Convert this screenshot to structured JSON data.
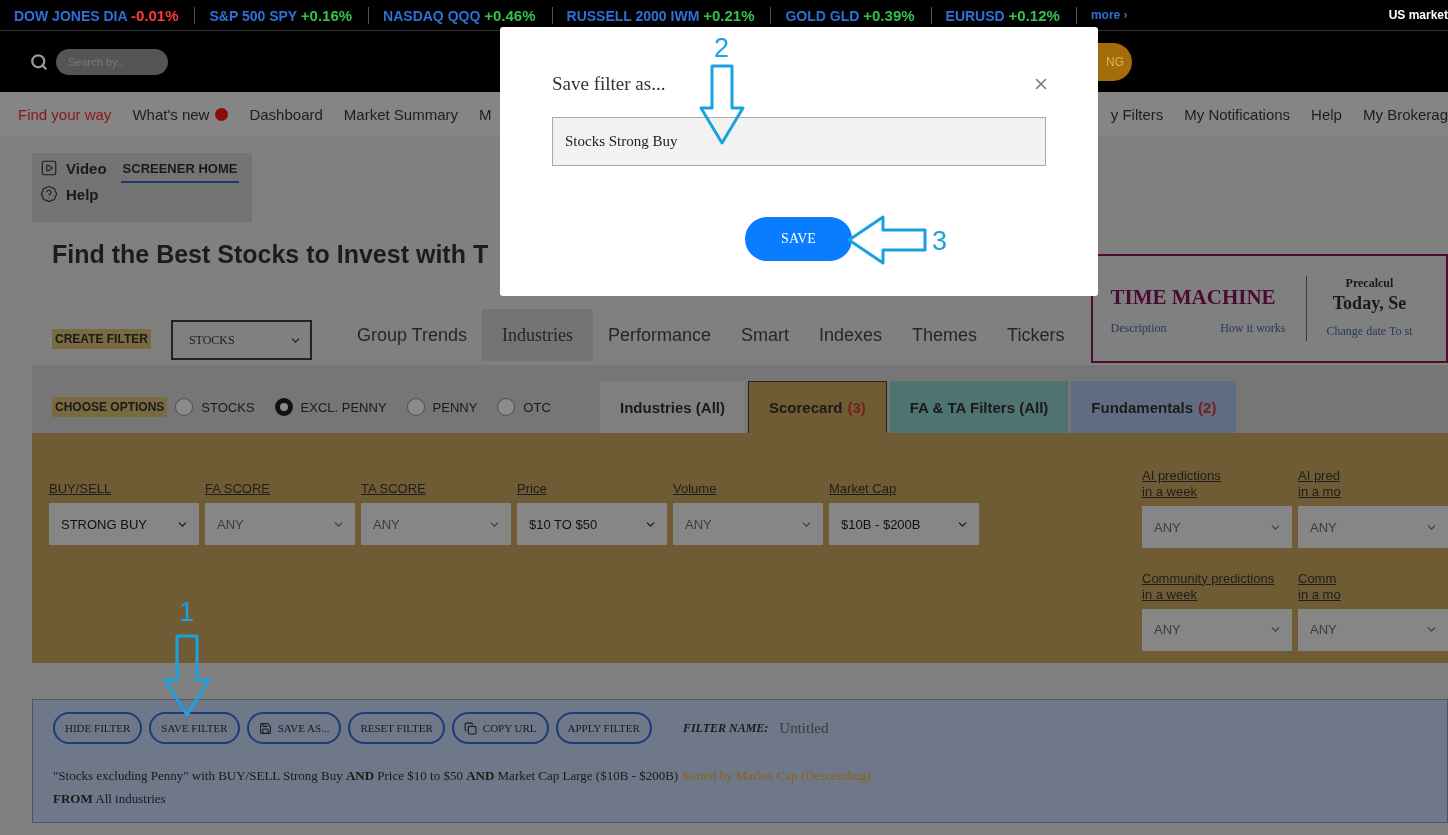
{
  "ticker": {
    "items": [
      {
        "name": "DOW JONES DIA",
        "change": "-0.01%",
        "color": "#ff3b3b"
      },
      {
        "name": "S&P 500 SPY",
        "change": "+0.16%",
        "color": "#33c24f"
      },
      {
        "name": "NASDAQ QQQ",
        "change": "+0.46%",
        "color": "#33c24f"
      },
      {
        "name": "RUSSELL 2000 IWM",
        "change": "+0.21%",
        "color": "#33c24f"
      },
      {
        "name": "GOLD GLD",
        "change": "+0.39%",
        "color": "#33c24f"
      },
      {
        "name": "EURUSD",
        "change": "+0.12%",
        "color": "#33c24f"
      }
    ],
    "more": "more ›",
    "status": "US market"
  },
  "header": {
    "search": {
      "placeholder": "Search by..."
    },
    "button": "NG"
  },
  "nav": {
    "left": [
      {
        "label": "Find your way",
        "kind": "highlight"
      },
      {
        "label": "What's new",
        "kind": "dot"
      },
      {
        "label": "Dashboard",
        "kind": "plain"
      },
      {
        "label": "Market Summary",
        "kind": "plain"
      },
      {
        "label": "M",
        "kind": "plain"
      }
    ],
    "right": [
      "y Filters",
      "My Notifications",
      "Help",
      "My Brokerag"
    ]
  },
  "screener_menu": {
    "links": [
      "Video",
      "Help"
    ],
    "tab": "SCREENER HOME"
  },
  "heading": "Find the Best Stocks to Invest with T",
  "create_filter": {
    "label": "CREATE FILTER",
    "select": "STOCKS"
  },
  "tabs": [
    {
      "label": "Group Trends",
      "selected": false
    },
    {
      "label": "Industries",
      "selected": true
    },
    {
      "label": "Performance",
      "selected": false
    },
    {
      "label": "Smart",
      "selected": false
    },
    {
      "label": "Indexes",
      "selected": false
    },
    {
      "label": "Themes",
      "selected": false
    },
    {
      "label": "Tickers",
      "selected": false
    }
  ],
  "time_machine": {
    "title": "TIME MACHINE",
    "links": [
      "Description",
      "How it works"
    ],
    "note": "Precalcul",
    "date": "Today, Se",
    "change_link": "Change date To st"
  },
  "options": {
    "label": "CHOOSE OPTIONS",
    "radios": [
      {
        "label": "STOCKS",
        "selected": false
      },
      {
        "label": "EXCL. PENNY",
        "selected": true
      },
      {
        "label": "PENNY",
        "selected": false
      },
      {
        "label": "OTC",
        "selected": false
      }
    ]
  },
  "filter_tabs": [
    {
      "label": "Industries (All)",
      "kind": "plain",
      "selected": false
    },
    {
      "label": "Scorecard",
      "count": "(3)",
      "kind": "gold",
      "selected": true
    },
    {
      "label": "FA & TA Filters (All)",
      "kind": "teal",
      "selected": false
    },
    {
      "label": "Fundamentals",
      "count": "(2)",
      "kind": "blue",
      "selected": false
    }
  ],
  "filters": [
    {
      "label": "BUY/SELL",
      "value": "STRONG BUY",
      "muted": false
    },
    {
      "label": "FA SCORE",
      "value": "ANY",
      "muted": true
    },
    {
      "label": "TA SCORE",
      "value": "ANY",
      "muted": true
    },
    {
      "label": "Price",
      "value": "$10 TO $50",
      "muted": false
    },
    {
      "label": "Volume",
      "value": "ANY",
      "muted": true
    },
    {
      "label": "Market Cap",
      "value": "$10B - $200B",
      "muted": false
    }
  ],
  "prediction_filters": [
    {
      "lines": [
        "AI predictions",
        "in a week"
      ],
      "value": "ANY"
    },
    {
      "lines": [
        "AI pred",
        "in a mo"
      ],
      "value": "ANY"
    },
    {
      "lines": [
        "Community predictions",
        "in a week"
      ],
      "value": "ANY"
    },
    {
      "lines": [
        "Comm",
        "in a mo"
      ],
      "value": "ANY"
    }
  ],
  "filter_bar": {
    "buttons": [
      "HIDE FILTER",
      "SAVE FILTER",
      "SAVE AS...",
      "RESET FILTER",
      "COPY URL",
      "APPLY FILTER"
    ],
    "name_label": "FILTER NAME:",
    "name": "Untitled",
    "summary": "\"Stocks excluding Penny\" with BUY/SELL Strong Buy **AND** Price $10 to $50 **AND** Market Cap Large ($10B - $200B)",
    "sort": "Sorted by Market Cap (Descending)",
    "from": "**FROM** All industries"
  },
  "dialog": {
    "title": "Save filter as...",
    "value": "Stocks Strong Buy",
    "button": "SAVE"
  },
  "annotations": [
    "1",
    "2",
    "3"
  ]
}
